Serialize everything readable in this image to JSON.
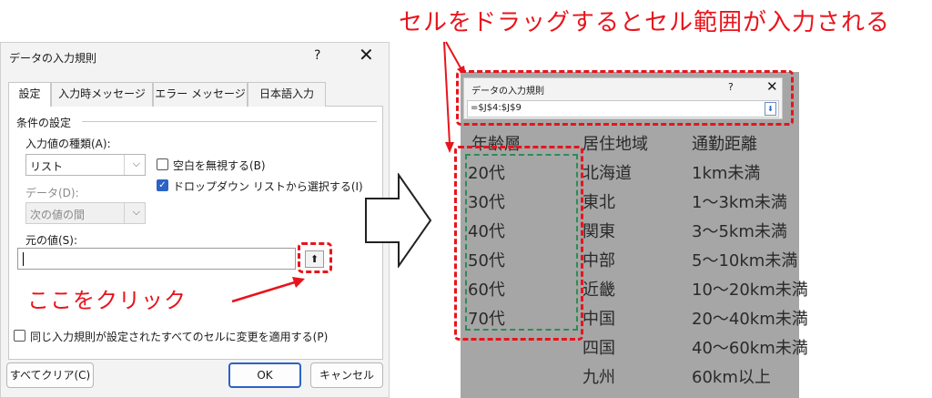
{
  "caption": "セルをドラッグするとセル範囲が入力される",
  "dialog": {
    "title": "データの入力規則",
    "help_label": "?",
    "close_label": "✕",
    "tabs": [
      "設定",
      "入力時メッセージ",
      "エラー メッセージ",
      "日本語入力"
    ],
    "active_tab": 0,
    "section_label": "条件の設定",
    "type_label": "入力値の種類(A):",
    "type_value": "リスト",
    "ignore_blank_label": "空白を無視する(B)",
    "ignore_blank_checked": false,
    "dropdown_label": "ドロップダウン リストから選択する(I)",
    "dropdown_checked": true,
    "data_label": "データ(D):",
    "data_value": "次の値の間",
    "source_label": "元の値(S):",
    "source_value": "",
    "apply_all_label": "同じ入力規則が設定されたすべてのセルに変更を適用する(P)",
    "apply_all_checked": false,
    "clear_all_label": "すべてクリア(C)",
    "ok_label": "OK",
    "cancel_label": "キャンセル"
  },
  "annotation": {
    "click_here": "ここをクリック"
  },
  "mini_dialog": {
    "title": "データの入力規則",
    "help_label": "?",
    "close_label": "✕",
    "value": "=$J$4:$J$9"
  },
  "sheet": {
    "headers": [
      "年齢層",
      "居住地域",
      "通勤距離"
    ],
    "age": [
      "20代",
      "30代",
      "40代",
      "50代",
      "60代",
      "70代"
    ],
    "region": [
      "北海道",
      "東北",
      "関東",
      "中部",
      "近畿",
      "中国",
      "四国",
      "九州"
    ],
    "distance": [
      "1km未満",
      "1～3km未満",
      "3～5km未満",
      "5～10km未満",
      "10～20km未満",
      "20～40km未満",
      "40～60km未満",
      "60km以上"
    ]
  },
  "colors": {
    "annotation_red": "#e8141c",
    "selection_green": "#2e8b57",
    "accent_blue": "#2b63c6"
  }
}
